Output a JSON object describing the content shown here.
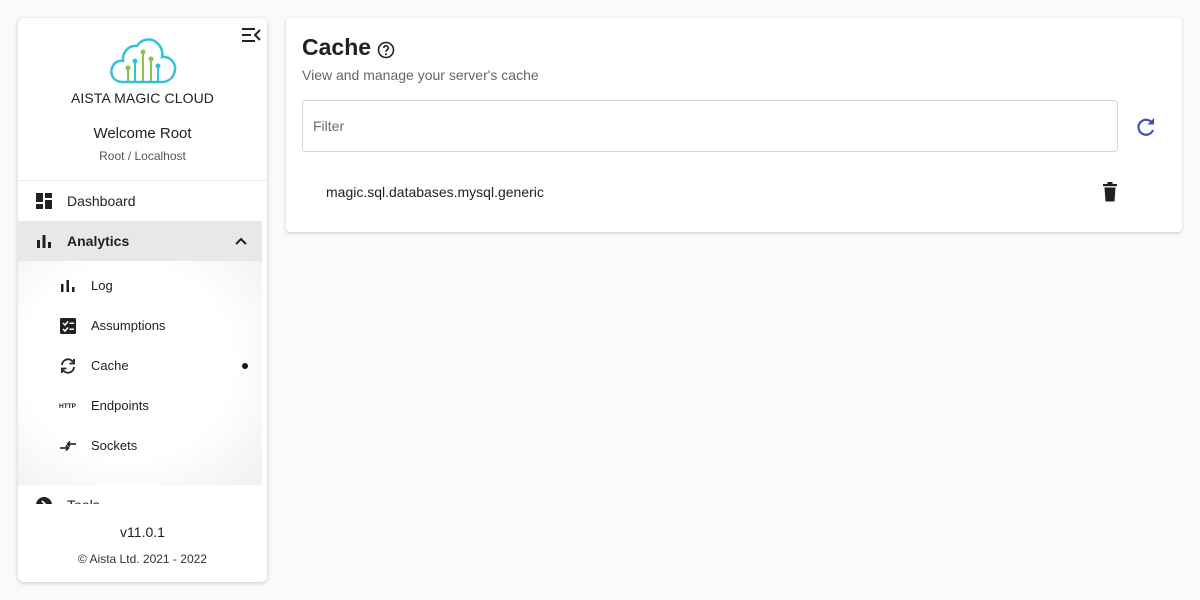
{
  "sidebar": {
    "brand_name": "AISTA MAGIC CLOUD",
    "welcome": "Welcome Root",
    "user_sub": "Root / Localhost",
    "nav": {
      "dashboard": "Dashboard",
      "analytics": "Analytics",
      "tools": "Tools"
    },
    "submenu": {
      "log": "Log",
      "assumptions": "Assumptions",
      "cache": "Cache",
      "endpoints": "Endpoints",
      "sockets": "Sockets"
    },
    "version": "v11.0.1",
    "copyright": "© Aista Ltd. 2021 - 2022"
  },
  "main": {
    "title": "Cache",
    "subtitle": "View and manage your server's cache",
    "filter_placeholder": "Filter",
    "cache_items": [
      "magic.sql.databases.mysql.generic"
    ]
  },
  "icons": {
    "accent": "#3f51b5",
    "logo_cyan": "#33c2d9",
    "logo_green": "#8bc34a"
  }
}
